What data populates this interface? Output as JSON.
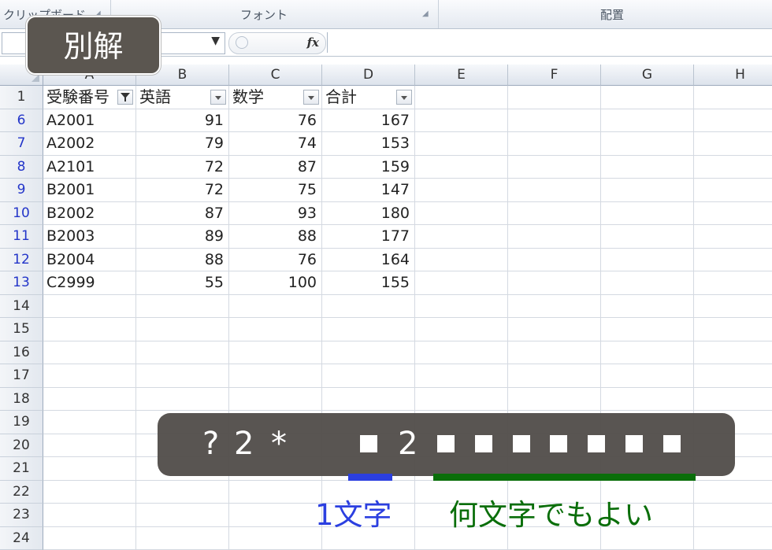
{
  "ribbon": {
    "groups": [
      {
        "label": "クリップボード"
      },
      {
        "label": "フォント"
      },
      {
        "label": "配置"
      }
    ]
  },
  "formula_bar": {
    "name_box": "",
    "fx_label": "fx",
    "formula": ""
  },
  "badge": {
    "label": "別解"
  },
  "sheet": {
    "columns": [
      "A",
      "B",
      "C",
      "D",
      "E",
      "F",
      "G",
      "H"
    ],
    "header_row": {
      "row": "1",
      "cells": [
        "受験番号",
        "英語",
        "数学",
        "合計"
      ]
    },
    "rows": [
      {
        "row": "6",
        "id": "A2001",
        "eng": "91",
        "math": "76",
        "total": "167"
      },
      {
        "row": "7",
        "id": "A2002",
        "eng": "79",
        "math": "74",
        "total": "153"
      },
      {
        "row": "8",
        "id": "A2101",
        "eng": "72",
        "math": "87",
        "total": "159"
      },
      {
        "row": "9",
        "id": "B2001",
        "eng": "72",
        "math": "75",
        "total": "147"
      },
      {
        "row": "10",
        "id": "B2002",
        "eng": "87",
        "math": "93",
        "total": "180"
      },
      {
        "row": "11",
        "id": "B2003",
        "eng": "89",
        "math": "88",
        "total": "177"
      },
      {
        "row": "12",
        "id": "B2004",
        "eng": "88",
        "math": "76",
        "total": "164"
      },
      {
        "row": "13",
        "id": "C2999",
        "eng": "55",
        "math": "100",
        "total": "155"
      }
    ],
    "empty_rows": [
      "14",
      "15",
      "16",
      "17",
      "18",
      "19",
      "20",
      "21",
      "22",
      "23",
      "24"
    ]
  },
  "pattern": {
    "tokens": [
      "?",
      "2",
      "*",
      "2"
    ],
    "colors": {
      "one_char": "#2b3fe0",
      "any_chars": "#0a6e0a"
    },
    "captions": {
      "one_char": "1文字",
      "any_chars": "何文字でもよい"
    }
  }
}
